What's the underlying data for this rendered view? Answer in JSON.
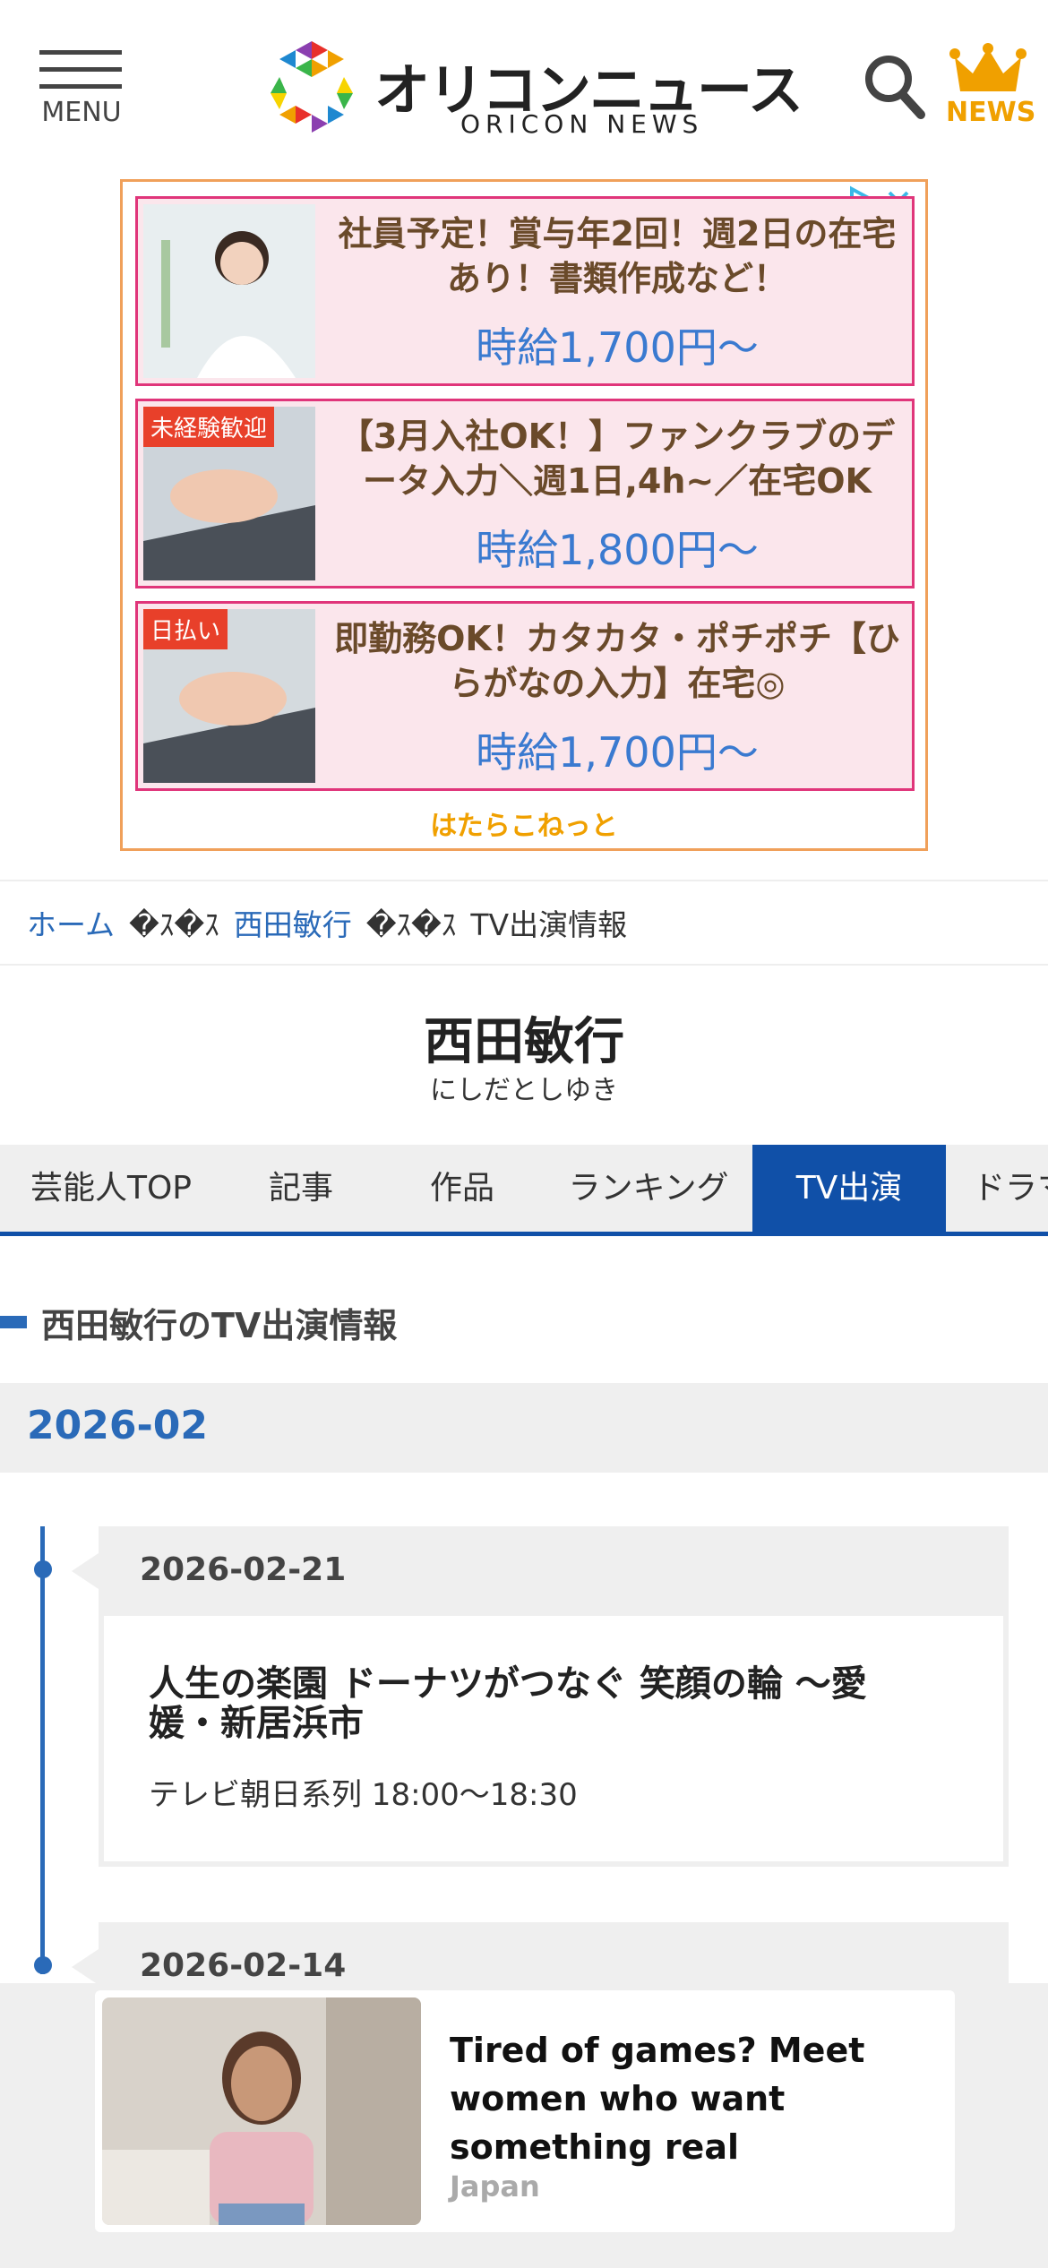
{
  "header": {
    "menu_label": "MENU",
    "logo_jp": "オリコンニュース",
    "logo_en": "ORICON NEWS",
    "news_label": "NEWS",
    "logo_colors": [
      "#e8302a",
      "#f0a000",
      "#f7d400",
      "#3ab54a",
      "#1e88d0",
      "#8b3fb0"
    ],
    "accent_color": "#f0a000"
  },
  "ad": {
    "items": [
      {
        "tag": "",
        "text": "社員予定！賞与年2回！週2日の在宅あり！書類作成など！",
        "price": "時給1,700円～"
      },
      {
        "tag": "未経験歓迎",
        "text": "【3月入社OK！】ファンクラブのデータ入力＼週1日,4h~／在宅OK",
        "price": "時給1,800円～"
      },
      {
        "tag": "日払い",
        "text": "即勤務OK！カタカタ・ポチポチ【ひらがなの入力】在宅◎",
        "price": "時給1,700円～"
      }
    ],
    "footer": "はたらこねっと"
  },
  "breadcrumb": {
    "home": "ホーム",
    "separator": "�ｽ�ｽ",
    "person": "西田敏行",
    "current": "TV出演情報"
  },
  "person": {
    "name": "西田敏行",
    "kana": "にしだとしゆき"
  },
  "tabs": [
    {
      "label": "芸能人TOP",
      "active": false
    },
    {
      "label": "記事",
      "active": false
    },
    {
      "label": "作品",
      "active": false
    },
    {
      "label": "ランキング",
      "active": false
    },
    {
      "label": "TV出演",
      "active": true
    },
    {
      "label": "ドラマ",
      "active": false
    }
  ],
  "section": {
    "title": "西田敏行のTV出演情報",
    "month": "2026-02"
  },
  "entries": [
    {
      "date": "2026-02-21",
      "title": "人生の楽園 ドーナツがつなぐ 笑顔の輪 ～愛媛・新居浜市",
      "meta": "テレビ朝日系列 18:00～18:30"
    },
    {
      "date": "2026-02-14"
    }
  ],
  "sticky_ad": {
    "text": "Tired of games? Meet women who want something real",
    "source": "Japan"
  }
}
